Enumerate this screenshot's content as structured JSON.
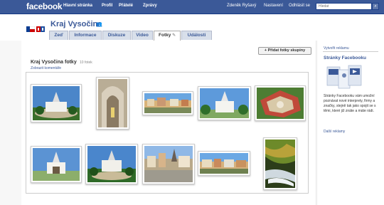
{
  "topbar": {
    "logo": "facebook",
    "nav_left": [
      "Hlavní stránka",
      "Profil",
      "Přátelé",
      "Zprávy"
    ],
    "user": "Zdeněk Ryšavý",
    "settings": "Nastavení",
    "logout": "Odhlásit se",
    "search_placeholder": "Hledat"
  },
  "page": {
    "name": "Kraj Vysočina",
    "tabs": [
      "Zeď",
      "Informace",
      "Diskuze",
      "Video",
      "Fotky",
      "Události"
    ],
    "active_tab": "Fotky"
  },
  "album": {
    "add_button": "+ Přidat fotky skupiny",
    "title": "Kraj Vysočina fotky",
    "count": "10 fotek",
    "comments_link": "Zobrazit komentáře"
  },
  "sidebar": {
    "create_ad": "Vytvořit reklamu",
    "title": "Stránky Facebooku",
    "text": "Stránky Facebooku vám umožní poznávat nové interprety, firmy a značky, stejně tak jako spojit se s těmi, které již znáte a máte rádi.",
    "more_ads": "Další reklamy"
  },
  "colors": {
    "brand": "#3b5998",
    "tab_bg": "#d8dfea"
  },
  "photos": [
    {
      "name": "church-round-garden"
    },
    {
      "name": "church-gothic-interior"
    },
    {
      "name": "town-square-panorama"
    },
    {
      "name": "church-white-walls"
    },
    {
      "name": "star-fortress-aerial"
    },
    {
      "name": "church-gate-view"
    },
    {
      "name": "church-hedge-garden"
    },
    {
      "name": "town-square-day"
    },
    {
      "name": "town-square-wide"
    },
    {
      "name": "forest-stream-autumn"
    }
  ]
}
